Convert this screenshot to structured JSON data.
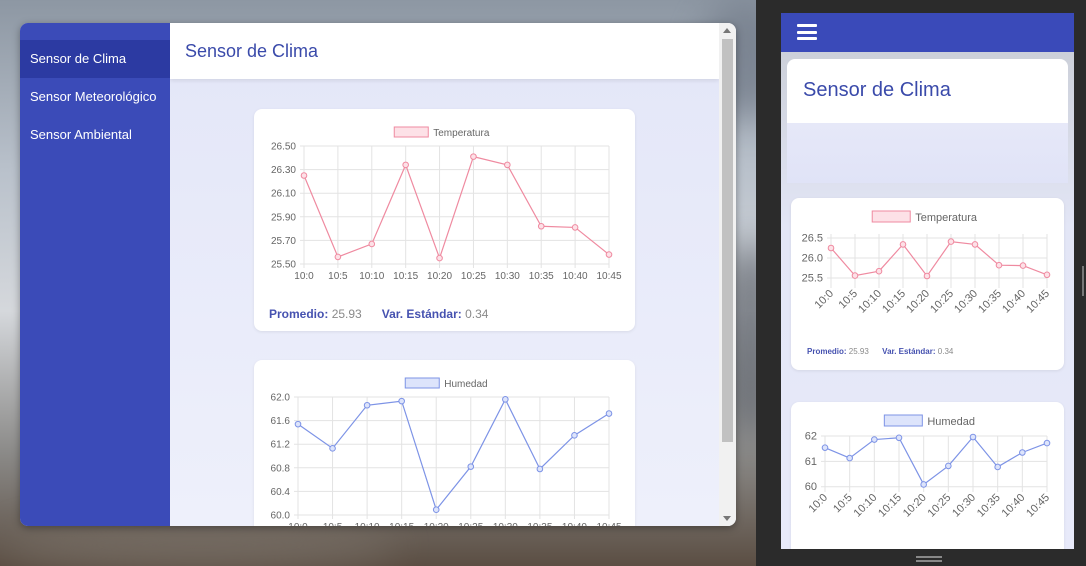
{
  "sidebar": {
    "items": [
      {
        "label": "Sensor de Clima",
        "active": true
      },
      {
        "label": "Sensor Meteorológico",
        "active": false
      },
      {
        "label": "Sensor Ambiental",
        "active": false
      }
    ]
  },
  "header": {
    "title": "Sensor de Clima"
  },
  "stats": {
    "avg_label": "Promedio:",
    "avg_value": "25.93",
    "std_label": "Var. Estándar:",
    "std_value": "0.34"
  },
  "mobile": {
    "header_title": "Sensor de Clima",
    "menu_icon": "hamburger-menu-icon"
  },
  "colors": {
    "sidebar": "#3b4bb8",
    "sidebar_active": "#2c3aa2",
    "accent_title": "#3a4aaa",
    "temp_line": "#ef8aa0",
    "temp_fill": "#fde1e7",
    "hum_line": "#7d93e6",
    "hum_fill": "#dde4fb"
  },
  "chart_data": [
    {
      "type": "line",
      "legend": "Temperatura",
      "categories": [
        "10:0",
        "10:5",
        "10:10",
        "10:15",
        "10:20",
        "10:25",
        "10:30",
        "10:35",
        "10:40",
        "10:45"
      ],
      "series": [
        {
          "name": "Temperatura",
          "values": [
            26.25,
            25.56,
            25.67,
            26.34,
            25.55,
            26.41,
            26.34,
            25.82,
            25.81,
            25.58
          ]
        }
      ],
      "desktop_yticks": [
        "26.50",
        "26.30",
        "26.10",
        "25.90",
        "25.70",
        "25.50"
      ],
      "desktop_ylim": [
        25.5,
        26.5
      ],
      "mobile_yticks": [
        "26.5",
        "26.0",
        "25.5"
      ],
      "mobile_ylim": [
        25.35,
        26.6
      ],
      "grid": true,
      "legend_position": "top"
    },
    {
      "type": "line",
      "legend": "Humedad",
      "categories": [
        "10:0",
        "10:5",
        "10:10",
        "10:15",
        "10:20",
        "10:25",
        "10:30",
        "10:35",
        "10:40",
        "10:45"
      ],
      "series": [
        {
          "name": "Humedad",
          "values": [
            61.54,
            61.13,
            61.86,
            61.93,
            60.09,
            60.82,
            61.96,
            60.78,
            61.35,
            61.72
          ]
        }
      ],
      "desktop_yticks": [
        "62.0",
        "61.6",
        "61.2",
        "60.8",
        "60.4",
        "60.0"
      ],
      "desktop_ylim": [
        60.0,
        62.0
      ],
      "mobile_yticks": [
        "62",
        "61",
        "60"
      ],
      "mobile_ylim": [
        59.95,
        62.0
      ],
      "grid": true,
      "legend_position": "top"
    }
  ]
}
